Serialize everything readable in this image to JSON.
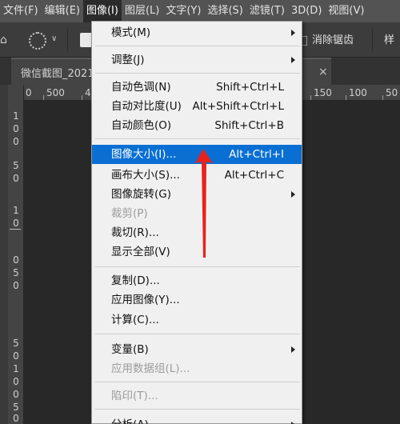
{
  "menubar": {
    "items": [
      {
        "label": "文件(F)"
      },
      {
        "label": "编辑(E)"
      },
      {
        "label": "图像(I)"
      },
      {
        "label": "图层(L)"
      },
      {
        "label": "文字(Y)"
      },
      {
        "label": "选择(S)"
      },
      {
        "label": "滤镜(T)"
      },
      {
        "label": "3D(D)"
      },
      {
        "label": "视图(V)"
      }
    ]
  },
  "options_bar": {
    "antialias_label": "消除锯齿",
    "style_label": "样",
    "home_icon": "home-icon",
    "marquee_icon": "elliptical-marquee-icon"
  },
  "tabbar": {
    "doc_title": "微信截图_2021",
    "close_symbol": "×"
  },
  "rulers": {
    "horizontal": [
      "0",
      "500",
      "4",
      "150",
      "100",
      "50"
    ],
    "vertical": [
      "1",
      "0",
      "0",
      "5",
      "0",
      "1",
      "0",
      "0",
      "5",
      "0",
      "5",
      "0",
      "1",
      "0",
      "0",
      "5",
      "0"
    ]
  },
  "image_menu": {
    "items": [
      {
        "label": "模式(M)",
        "shortcut": "",
        "submenu": true,
        "disabled": false
      },
      {
        "label": "调整(J)",
        "shortcut": "",
        "submenu": true,
        "disabled": false
      },
      {
        "label": "自动色调(N)",
        "shortcut": "Shift+Ctrl+L",
        "submenu": false,
        "disabled": false
      },
      {
        "label": "自动对比度(U)",
        "shortcut": "Alt+Shift+Ctrl+L",
        "submenu": false,
        "disabled": false
      },
      {
        "label": "自动颜色(O)",
        "shortcut": "Shift+Ctrl+B",
        "submenu": false,
        "disabled": false
      },
      {
        "label": "图像大小(I)...",
        "shortcut": "Alt+Ctrl+I",
        "submenu": false,
        "disabled": false,
        "highlighted": true
      },
      {
        "label": "画布大小(S)...",
        "shortcut": "Alt+Ctrl+C",
        "submenu": false,
        "disabled": false
      },
      {
        "label": "图像旋转(G)",
        "shortcut": "",
        "submenu": true,
        "disabled": false
      },
      {
        "label": "裁剪(P)",
        "shortcut": "",
        "submenu": false,
        "disabled": true
      },
      {
        "label": "裁切(R)...",
        "shortcut": "",
        "submenu": false,
        "disabled": false
      },
      {
        "label": "显示全部(V)",
        "shortcut": "",
        "submenu": false,
        "disabled": false
      },
      {
        "label": "复制(D)...",
        "shortcut": "",
        "submenu": false,
        "disabled": false
      },
      {
        "label": "应用图像(Y)...",
        "shortcut": "",
        "submenu": false,
        "disabled": false
      },
      {
        "label": "计算(C)...",
        "shortcut": "",
        "submenu": false,
        "disabled": false
      },
      {
        "label": "变量(B)",
        "shortcut": "",
        "submenu": true,
        "disabled": false
      },
      {
        "label": "应用数据组(L)...",
        "shortcut": "",
        "submenu": false,
        "disabled": true
      },
      {
        "label": "陷印(T)...",
        "shortcut": "",
        "submenu": false,
        "disabled": true
      },
      {
        "label": "分析(A)",
        "shortcut": "",
        "submenu": true,
        "disabled": false
      }
    ]
  },
  "colors": {
    "highlight": "#0a6fd3",
    "annotation_arrow": "#e8221b",
    "menubar": "#535353",
    "canvas": "#282828"
  }
}
